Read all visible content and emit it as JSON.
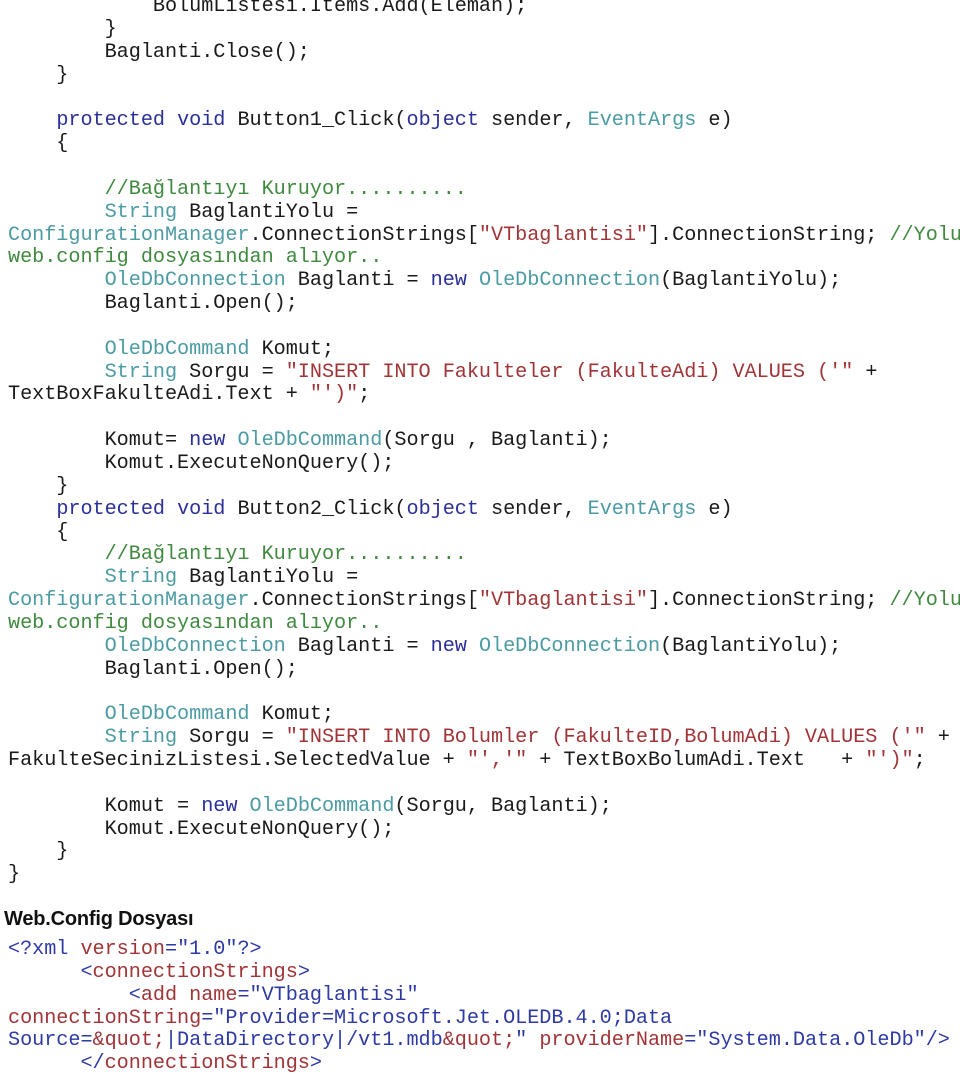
{
  "document": {
    "colors": {
      "plain": "#1a1a1a",
      "keyword": "#2b2f98",
      "type": "#4b9ba3",
      "string": "#a13437",
      "comment": "#3f8a3f",
      "xml_bracket": "#2e3aa4",
      "xml_name": "#a13437",
      "xml_value": "#2e3aa4"
    },
    "code_lines": [
      [
        [
          "plain",
          "            BolumListesi.Items.Add(Eleman);"
        ]
      ],
      [
        [
          "plain",
          "        }"
        ]
      ],
      [
        [
          "plain",
          "        Baglanti.Close();"
        ]
      ],
      [
        [
          "plain",
          "    }"
        ]
      ],
      [],
      [
        [
          "plain",
          "    "
        ],
        [
          "kw",
          "protected"
        ],
        [
          "plain",
          " "
        ],
        [
          "kw",
          "void"
        ],
        [
          "plain",
          " Button1_Click("
        ],
        [
          "kw",
          "object"
        ],
        [
          "plain",
          " sender, "
        ],
        [
          "type",
          "EventArgs"
        ],
        [
          "plain",
          " e)"
        ]
      ],
      [
        [
          "plain",
          "    {"
        ]
      ],
      [],
      [
        [
          "plain",
          "        "
        ],
        [
          "cmt",
          "//Bağlantıyı Kuruyor.........."
        ]
      ],
      [
        [
          "plain",
          "        "
        ],
        [
          "type",
          "String"
        ],
        [
          "plain",
          " BaglantiYolu ="
        ]
      ],
      [
        [
          "type",
          "ConfigurationManager"
        ],
        [
          "plain",
          ".ConnectionStrings["
        ],
        [
          "str",
          "\"VTbaglantisi\""
        ],
        [
          "plain",
          "].ConnectionString; "
        ],
        [
          "cmt",
          "//Yolu"
        ]
      ],
      [
        [
          "cmt",
          "web.config dosyasından alıyor.."
        ]
      ],
      [
        [
          "plain",
          "        "
        ],
        [
          "type",
          "OleDbConnection"
        ],
        [
          "plain",
          " Baglanti = "
        ],
        [
          "kw",
          "new"
        ],
        [
          "plain",
          " "
        ],
        [
          "type",
          "OleDbConnection"
        ],
        [
          "plain",
          "(BaglantiYolu);"
        ]
      ],
      [
        [
          "plain",
          "        Baglanti.Open();"
        ]
      ],
      [],
      [
        [
          "plain",
          "        "
        ],
        [
          "type",
          "OleDbCommand"
        ],
        [
          "plain",
          " Komut;"
        ]
      ],
      [
        [
          "plain",
          "        "
        ],
        [
          "type",
          "String"
        ],
        [
          "plain",
          " Sorgu = "
        ],
        [
          "str",
          "\"INSERT INTO Fakulteler (FakulteAdi) VALUES ('\""
        ],
        [
          "plain",
          " +"
        ]
      ],
      [
        [
          "plain",
          "TextBoxFakulteAdi.Text + "
        ],
        [
          "str",
          "\"')\""
        ],
        [
          "plain",
          ";"
        ]
      ],
      [],
      [
        [
          "plain",
          "        Komut= "
        ],
        [
          "kw",
          "new"
        ],
        [
          "plain",
          " "
        ],
        [
          "type",
          "OleDbCommand"
        ],
        [
          "plain",
          "(Sorgu , Baglanti);"
        ]
      ],
      [
        [
          "plain",
          "        Komut.ExecuteNonQuery();"
        ]
      ],
      [
        [
          "plain",
          "    }"
        ]
      ],
      [
        [
          "plain",
          "    "
        ],
        [
          "kw",
          "protected"
        ],
        [
          "plain",
          " "
        ],
        [
          "kw",
          "void"
        ],
        [
          "plain",
          " Button2_Click("
        ],
        [
          "kw",
          "object"
        ],
        [
          "plain",
          " sender, "
        ],
        [
          "type",
          "EventArgs"
        ],
        [
          "plain",
          " e)"
        ]
      ],
      [
        [
          "plain",
          "    {"
        ]
      ],
      [
        [
          "plain",
          "        "
        ],
        [
          "cmt",
          "//Bağlantıyı Kuruyor.........."
        ]
      ],
      [
        [
          "plain",
          "        "
        ],
        [
          "type",
          "String"
        ],
        [
          "plain",
          " BaglantiYolu ="
        ]
      ],
      [
        [
          "type",
          "ConfigurationManager"
        ],
        [
          "plain",
          ".ConnectionStrings["
        ],
        [
          "str",
          "\"VTbaglantisi\""
        ],
        [
          "plain",
          "].ConnectionString; "
        ],
        [
          "cmt",
          "//Yolu"
        ]
      ],
      [
        [
          "cmt",
          "web.config dosyasından alıyor.."
        ]
      ],
      [
        [
          "plain",
          "        "
        ],
        [
          "type",
          "OleDbConnection"
        ],
        [
          "plain",
          " Baglanti = "
        ],
        [
          "kw",
          "new"
        ],
        [
          "plain",
          " "
        ],
        [
          "type",
          "OleDbConnection"
        ],
        [
          "plain",
          "(BaglantiYolu);"
        ]
      ],
      [
        [
          "plain",
          "        Baglanti.Open();"
        ]
      ],
      [],
      [
        [
          "plain",
          "        "
        ],
        [
          "type",
          "OleDbCommand"
        ],
        [
          "plain",
          " Komut;"
        ]
      ],
      [
        [
          "plain",
          "        "
        ],
        [
          "type",
          "String"
        ],
        [
          "plain",
          " Sorgu = "
        ],
        [
          "str",
          "\"INSERT INTO Bolumler (FakulteID,BolumAdi) VALUES ('\""
        ],
        [
          "plain",
          " +"
        ]
      ],
      [
        [
          "plain",
          "FakulteSecinizListesi.SelectedValue + "
        ],
        [
          "str",
          "\"','\""
        ],
        [
          "plain",
          " + TextBoxBolumAdi.Text   + "
        ],
        [
          "str",
          "\"')\""
        ],
        [
          "plain",
          ";"
        ]
      ],
      [],
      [
        [
          "plain",
          "        Komut = "
        ],
        [
          "kw",
          "new"
        ],
        [
          "plain",
          " "
        ],
        [
          "type",
          "OleDbCommand"
        ],
        [
          "plain",
          "(Sorgu, Baglanti);"
        ]
      ],
      [
        [
          "plain",
          "        Komut.ExecuteNonQuery();"
        ]
      ],
      [
        [
          "plain",
          "    }"
        ]
      ],
      [
        [
          "plain",
          "}"
        ]
      ]
    ],
    "section_heading": "Web.Config Dosyası",
    "xml_lines": [
      [
        [
          "xbr",
          "<?xml "
        ],
        [
          "xname",
          "version"
        ],
        [
          "xbr",
          "="
        ],
        [
          "xval",
          "\"1.0\""
        ],
        [
          "xbr",
          "?>"
        ]
      ],
      [
        [
          "plain",
          "      "
        ],
        [
          "xbr",
          "<"
        ],
        [
          "xname",
          "connectionStrings"
        ],
        [
          "xbr",
          ">"
        ]
      ],
      [
        [
          "plain",
          "          "
        ],
        [
          "xbr",
          "<"
        ],
        [
          "xname",
          "add"
        ],
        [
          "plain",
          " "
        ],
        [
          "xname",
          "name"
        ],
        [
          "xbr",
          "="
        ],
        [
          "xval",
          "\"VTbaglantisi\""
        ]
      ],
      [
        [
          "xname",
          "connectionString"
        ],
        [
          "xbr",
          "="
        ],
        [
          "xval",
          "\"Provider=Microsoft.Jet.OLEDB.4.0;Data"
        ]
      ],
      [
        [
          "xval",
          "Source="
        ],
        [
          "xname",
          "&quot;"
        ],
        [
          "xval",
          "|DataDirectory|/vt1.mdb"
        ],
        [
          "xname",
          "&quot;"
        ],
        [
          "xval",
          "\""
        ],
        [
          "plain",
          " "
        ],
        [
          "xname",
          "providerName"
        ],
        [
          "xbr",
          "="
        ],
        [
          "xval",
          "\"System.Data.OleDb\""
        ],
        [
          "xbr",
          "/>"
        ]
      ],
      [
        [
          "plain",
          "      "
        ],
        [
          "xbr",
          "</"
        ],
        [
          "xname",
          "connectionStrings"
        ],
        [
          "xbr",
          ">"
        ]
      ]
    ]
  }
}
